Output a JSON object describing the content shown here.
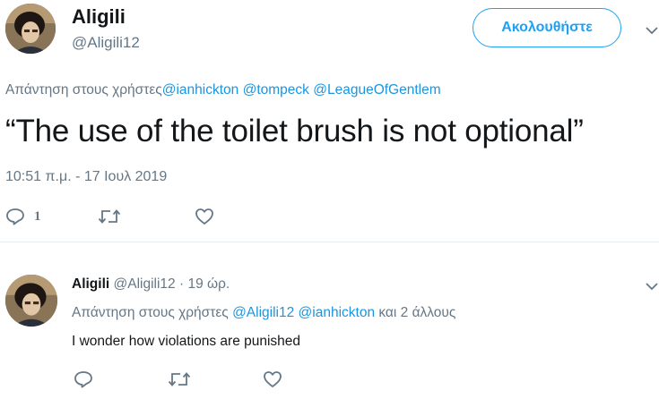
{
  "colors": {
    "accent": "#1da1f2",
    "link": "#1b95e0",
    "muted": "#657786",
    "text": "#14171a"
  },
  "main_tweet": {
    "name": "Aligili",
    "handle": "@Aligili12",
    "follow_label": "Ακολουθήστε",
    "reply_prefix": "Απάντηση στους χρήστες",
    "mentions": [
      "@ianhickton",
      "@tompeck",
      "@LeagueOfGentlem"
    ],
    "text": "“The use of the toilet brush is not optional”",
    "timestamp": "10:51 π.μ. - 17 Ιουλ 2019",
    "reply_count": "1",
    "icons": {
      "reply": "reply-icon",
      "retweet": "retweet-icon",
      "like": "heart-icon",
      "menu": "chevron-down-icon"
    }
  },
  "reply_tweet": {
    "name": "Aligili",
    "meta": "@Aligili12 · 19 ώρ.",
    "reply_prefix": "Απάντηση στους χρήστες",
    "mentions": [
      "@Aligili12",
      "@ianhickton"
    ],
    "others": "και 2 άλλους",
    "text": "I wonder how violations are punished"
  }
}
